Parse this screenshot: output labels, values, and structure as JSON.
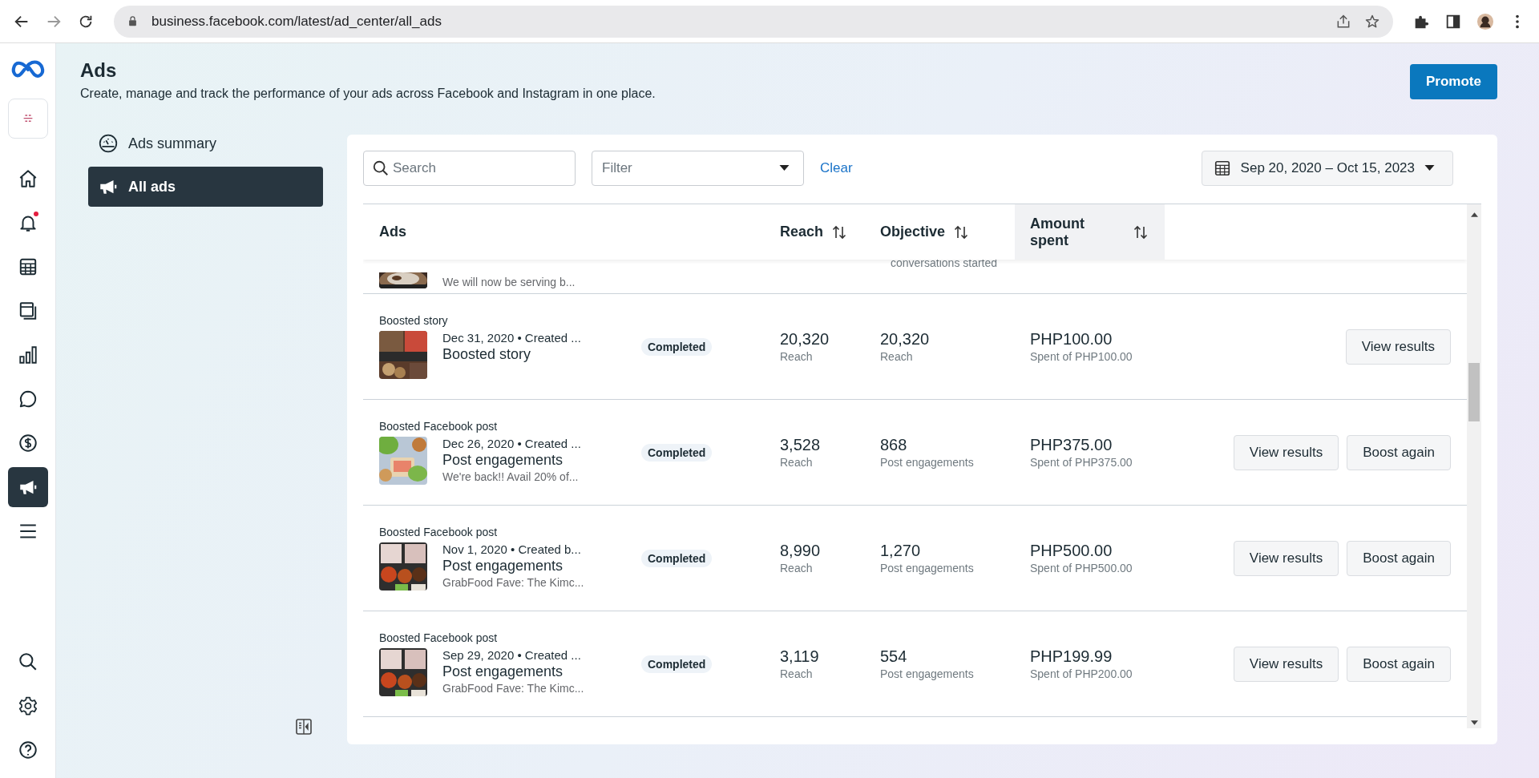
{
  "browser": {
    "url": "business.facebook.com/latest/ad_center/all_ads"
  },
  "rail": {
    "items": [
      {
        "selected": false
      },
      {
        "selected": false,
        "dot": true
      },
      {
        "selected": false
      },
      {
        "selected": false
      },
      {
        "selected": false
      },
      {
        "selected": false
      },
      {
        "selected": false
      },
      {
        "selected": true
      },
      {
        "selected": false
      }
    ],
    "bottom": [
      {
        "selected": false
      },
      {
        "selected": false
      },
      {
        "selected": false
      }
    ]
  },
  "page": {
    "title": "Ads",
    "subtitle": "Create, manage and track the performance of your ads across Facebook and Instagram in one place.",
    "promote": "Promote"
  },
  "nav": [
    {
      "label": "Ads summary",
      "selected": false
    },
    {
      "label": "All ads",
      "selected": true
    }
  ],
  "toolbar": {
    "search": {
      "placeholder": "Search"
    },
    "filter": {
      "placeholder": "Filter"
    },
    "clear": "Clear",
    "date_range": "Sep 20, 2020 – Oct 15, 2023"
  },
  "table": {
    "columns": [
      {
        "label": "Ads",
        "sortable": false,
        "highlighted": false
      },
      {
        "label": "Reach",
        "sortable": true,
        "highlighted": false
      },
      {
        "label": "Objective",
        "sortable": true,
        "highlighted": false
      },
      {
        "label": "Amount spent",
        "sortable": true,
        "highlighted": true
      }
    ],
    "rows": [
      {
        "kind": "partial",
        "description": "We will now be serving b...",
        "objective_label": "conversations started"
      },
      {
        "kind": "full",
        "type": "Boosted story",
        "date_line": "Dec 31, 2020 • Created ...",
        "title": "Boosted story",
        "status": "Completed",
        "reach": "20,320",
        "reach_label": "Reach",
        "objective_value": "20,320",
        "objective_label": "Reach",
        "amount": "PHP100.00",
        "amount_label": "Spent of PHP100.00",
        "actions": [
          "View results"
        ]
      },
      {
        "kind": "full",
        "type": "Boosted Facebook post",
        "date_line": "Dec 26, 2020 • Created ...",
        "title": "Post engagements",
        "description": "We're back!! Avail 20% of...",
        "status": "Completed",
        "reach": "3,528",
        "reach_label": "Reach",
        "objective_value": "868",
        "objective_label": "Post engagements",
        "amount": "PHP375.00",
        "amount_label": "Spent of PHP375.00",
        "actions": [
          "View results",
          "Boost again"
        ]
      },
      {
        "kind": "full",
        "type": "Boosted Facebook post",
        "date_line": "Nov 1, 2020 • Created b...",
        "title": "Post engagements",
        "description": "GrabFood Fave: The Kimc...",
        "status": "Completed",
        "reach": "8,990",
        "reach_label": "Reach",
        "objective_value": "1,270",
        "objective_label": "Post engagements",
        "amount": "PHP500.00",
        "amount_label": "Spent of PHP500.00",
        "actions": [
          "View results",
          "Boost again"
        ]
      },
      {
        "kind": "full",
        "type": "Boosted Facebook post",
        "date_line": "Sep 29, 2020 • Created ...",
        "title": "Post engagements",
        "description": "GrabFood Fave: The Kimc...",
        "status": "Completed",
        "reach": "3,119",
        "reach_label": "Reach",
        "objective_value": "554",
        "objective_label": "Post engagements",
        "amount": "PHP199.99",
        "amount_label": "Spent of PHP200.00",
        "actions": [
          "View results",
          "Boost again"
        ]
      }
    ]
  }
}
